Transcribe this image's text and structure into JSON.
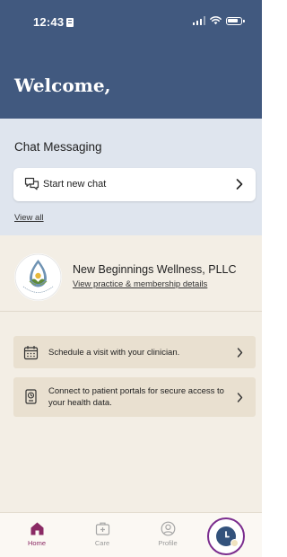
{
  "status_bar": {
    "time": "12:43"
  },
  "header": {
    "welcome": "Welcome,"
  },
  "chat": {
    "title": "Chat Messaging",
    "start_label": "Start new chat",
    "view_all": "View all"
  },
  "practice": {
    "name": "New Beginnings Wellness, PLLC",
    "link": "View practice & membership details"
  },
  "actions": [
    {
      "text": "Schedule a visit with your clinician."
    },
    {
      "text": "Connect to patient portals for secure access to your health data."
    }
  ],
  "nav": {
    "tabs": [
      {
        "label": "Home"
      },
      {
        "label": "Care"
      },
      {
        "label": "Profile"
      }
    ]
  },
  "colors": {
    "header": "#41597f",
    "chat_bg": "#dfe5ee",
    "page_bg": "#f3eee5",
    "card_bg": "#e9e0d0",
    "accent_home": "#8a2a64",
    "avatar_ring": "#7b2d8e"
  }
}
